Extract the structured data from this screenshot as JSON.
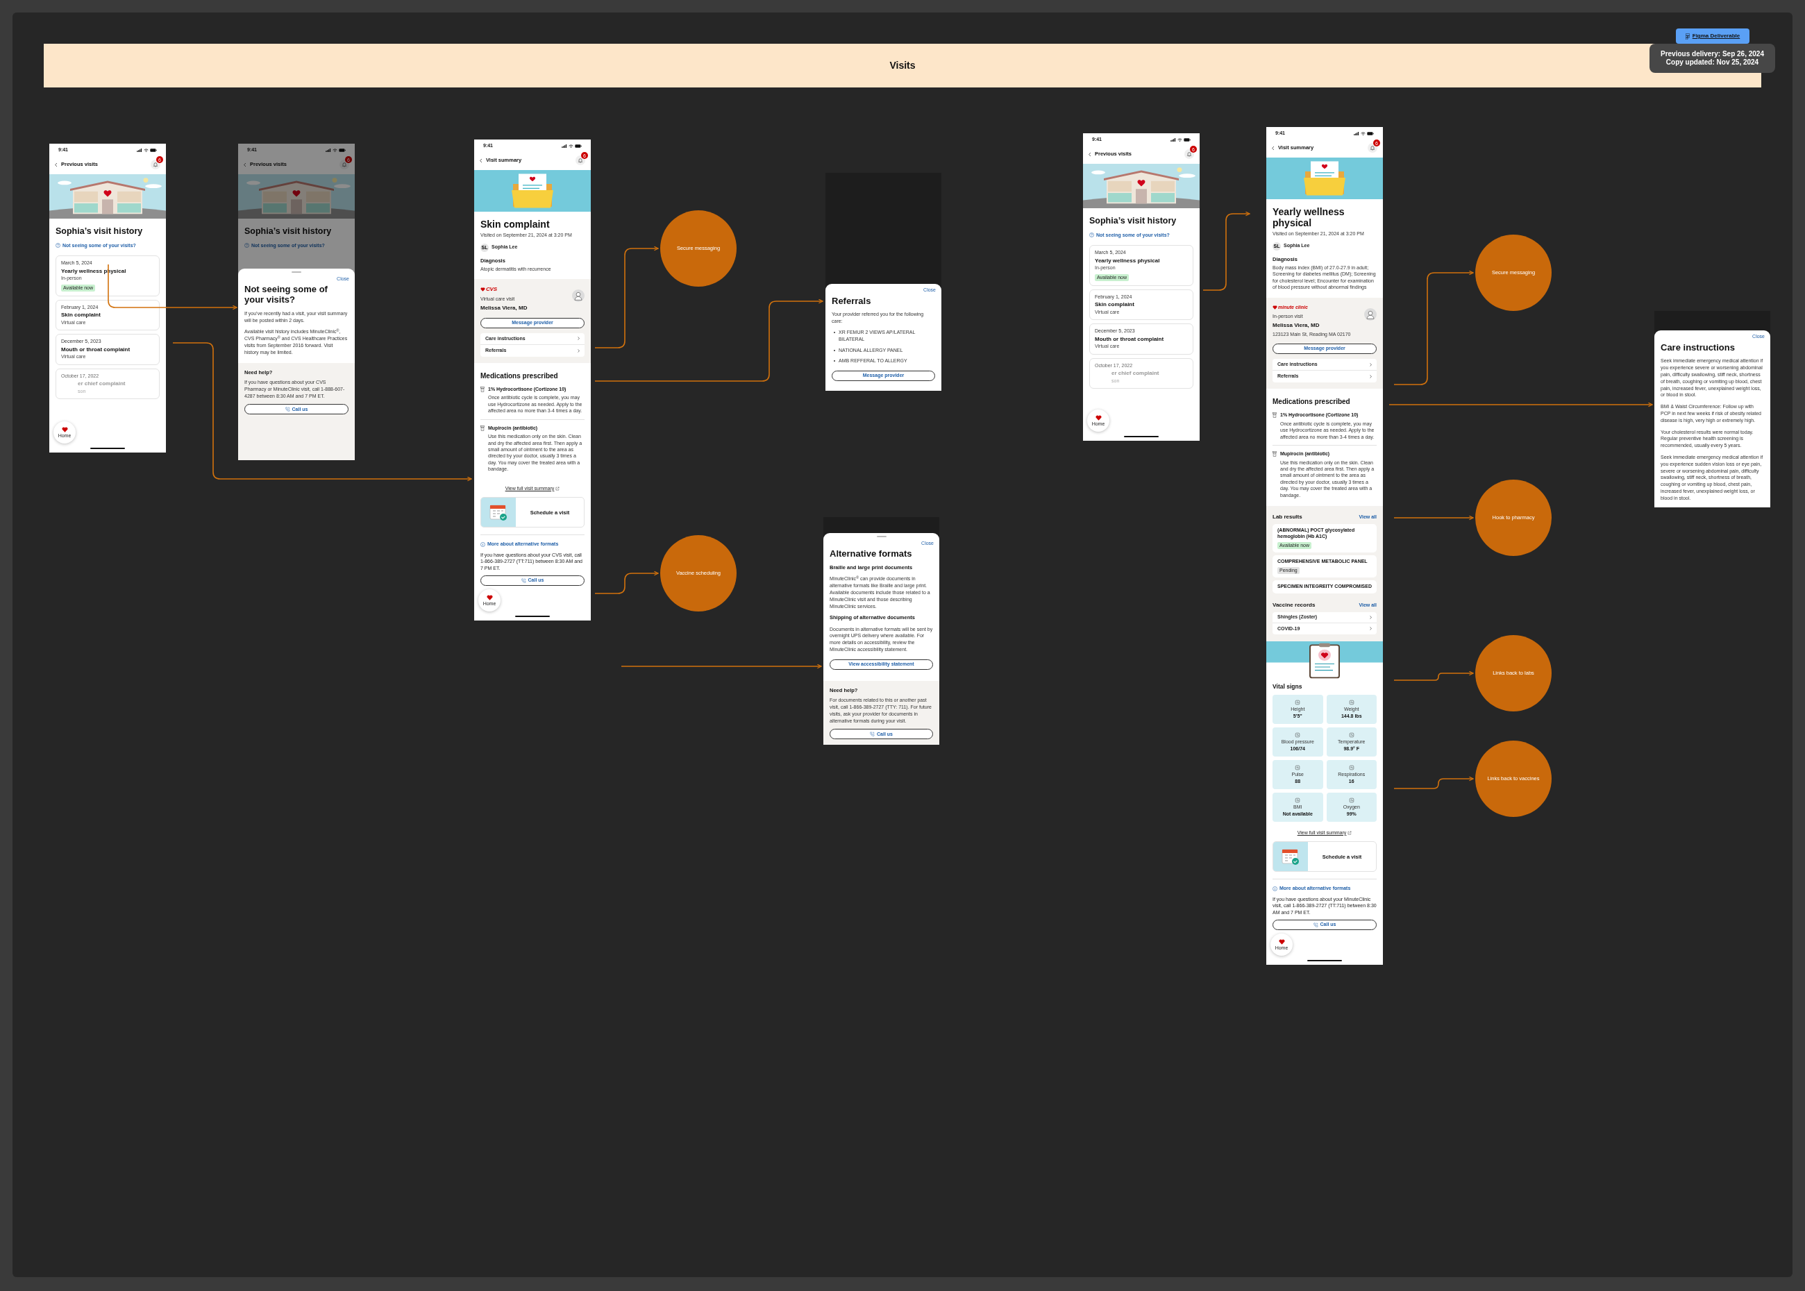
{
  "header": {
    "title": "Visits"
  },
  "deliverable_link": {
    "label": "Figma Deliverable"
  },
  "delivery_note": [
    "Previous delivery: Sep 26, 2024",
    "Copy updated: Nov 25, 2024"
  ],
  "frames": [
    {
      "kind": "history",
      "dimmed": false,
      "status_time": "9:41",
      "nav_title": "Previous visits",
      "notifications": "6",
      "title": "Sophia’s visit history",
      "help_link": "Not seeing some of your visits?",
      "visits": [
        {
          "date": "March 5, 2024",
          "title": "Yearly wellness physical",
          "type": "In-person",
          "faded": false,
          "tag": {
            "label": "Available now",
            "color": "#c8f0cf"
          }
        },
        {
          "date": "February 1, 2024",
          "title": "Skin complaint",
          "type": "Virtual care",
          "faded": false
        },
        {
          "date": "December 5, 2023",
          "title": "Mouth or throat complaint",
          "type": "Virtual care",
          "faded": false
        },
        {
          "date": "October 17, 2022",
          "title": "er chief complaint",
          "type": "son",
          "faded": true
        }
      ],
      "home": "Home"
    },
    {
      "kind": "history",
      "dimmed": true,
      "status_time": "9:41",
      "nav_title": "Previous visits",
      "notifications": "6",
      "title": "Sophia’s visit history",
      "help_link": "Not seeing some of your visits?",
      "sheet": {
        "handle": true,
        "close": "Close",
        "title": "Not seeing some of your visits?",
        "blocks": [
          {
            "kind": "paragraph",
            "text": "If you’ve recently had a visit, your visit summary will be posted within 2 days."
          },
          {
            "kind": "paragraph",
            "text": "Available visit history includes MinuteClinic$^{®}$, CVS Pharmacy$^{®}$ and CVS Healthcare Practices visits from September 2016 forward. Visit history may be limited."
          },
          {
            "kind": "help",
            "title": "Need help?",
            "text": "If you have questions about your CVS Pharmacy or MinuteClinic visit, call 1-888-607-4287 between 8:30 AM and 7 PM ET.",
            "button": "Call us"
          }
        ]
      }
    },
    {
      "kind": "summary",
      "status_time": "9:41",
      "nav_title": "Visit summary",
      "notifications": "6",
      "title": "Skin complaint",
      "visited": "Visited on September 21, 2024 at 3:20 PM",
      "patient_initials": "SL",
      "patient": "Sophia Lee",
      "diagnosis_label": "Diagnosis",
      "diagnosis": "Atopic dermatitis with recurrence",
      "brand": {
        "kind": "cvs",
        "label": "CVS"
      },
      "visit_type": "Virtual care visit",
      "provider": "Melissa Viera, MD",
      "message_button": "Message provider",
      "links": [
        "Care instructions",
        "Referrals"
      ],
      "meds_title": "Medications prescribed",
      "meds": [
        {
          "name": "1% Hydrocortisone (Cortizone 10)",
          "text": "Once antibiotic cycle is complete, you may use Hydrocortizone as needed. Apply to the affected area no more than 3-4 times a day."
        },
        {
          "name": "Mupirocin (antibiotic)",
          "text": "Use this medication only on the skin. Clean and dry the affected area first. Then apply a small amount of ointment to the area as directed by your doctor, usually 3 times a day. You may cover the treated area with a bandage."
        }
      ],
      "full_summary_link": "View full visit summary",
      "schedule": "Schedule a visit",
      "alt_formats_link": "More about alternative formats",
      "contact": "If you have questions about your CVS visit, call 1-866-389-2727 (TT:711) between 8:30 AM and 7 PM ET.",
      "call_button": "Call us",
      "home": "Home"
    },
    {
      "kind": "modal",
      "sheet": {
        "handle": false,
        "close": "Close",
        "title": "Referrals",
        "blocks": [
          {
            "kind": "paragraph",
            "text": "Your provider referred you for the following care:"
          },
          {
            "kind": "bullets",
            "items": [
              "XR FEMUR 2 VIEWS AP/LATERAL BILATERAL",
              "NATIONAL ALLERGY PANEL",
              "AMB REFFERAL TO ALLERGY"
            ]
          },
          {
            "kind": "button",
            "label": "Message provider"
          }
        ]
      }
    },
    {
      "kind": "modal",
      "sheet": {
        "handle": true,
        "close": "Close",
        "title": "Alternative formats",
        "blocks": [
          {
            "kind": "heading",
            "text": "Braille and large print documents"
          },
          {
            "kind": "paragraph",
            "text": "MinuteClinic$^{®}$ can provide documents in alternative formats like Braille and large print. Available documents include those related to a MinuteClinic visit and those describing MinuteClinic services."
          },
          {
            "kind": "heading",
            "text": "Shipping of alternative documents"
          },
          {
            "kind": "paragraph",
            "text": "Documents in alternative formats will be sent by overnight UPS delivery where available. For more details on accessibility, review the MinuteClinic accessibility statement."
          },
          {
            "kind": "button",
            "label": "View accessibility statement"
          },
          {
            "kind": "help",
            "title": "Need help?",
            "text": "For documents related to this or another past visit, call 1-866-389-2727 (TTY: 711). For future visits, ask your provider for documents in alternative formats during your visit.",
            "button": "Call us"
          }
        ]
      }
    },
    {
      "kind": "history",
      "dimmed": false,
      "status_time": "9:41",
      "nav_title": "Previous visits",
      "notifications": "6",
      "title": "Sophia’s visit history",
      "help_link": "Not seeing some of your visits?",
      "visits": [
        {
          "date": "March 5, 2024",
          "title": "Yearly wellness physical",
          "type": "In-person",
          "faded": false,
          "tag": {
            "label": "Available now",
            "color": "#c8f0cf"
          }
        },
        {
          "date": "February 1, 2024",
          "title": "Skin complaint",
          "type": "Virtual care",
          "faded": false
        },
        {
          "date": "December 5, 2023",
          "title": "Mouth or throat complaint",
          "type": "Virtual care",
          "faded": false
        },
        {
          "date": "October 17, 2022",
          "title": "er chief complaint",
          "type": "son",
          "faded": true
        }
      ],
      "home": "Home"
    },
    {
      "kind": "summary",
      "status_time": "9:41",
      "nav_title": "Visit summary",
      "notifications": "6",
      "title": "Yearly wellness physical",
      "visited": "Visited on September 21, 2024 at 3:20 PM",
      "patient_initials": "SL",
      "patient": "Sophia Lee",
      "diagnosis_label": "Diagnosis",
      "diagnosis": "Body mass index (BMI) of 27.0-27.9 in adult; Screening for diabetes mellitus (DM); Screening for cholesterol level; Encounter for examination of blood pressure without abnormal findings",
      "brand": {
        "kind": "minuteclinic",
        "label": "minute clinic"
      },
      "visit_type": "In-person visit",
      "provider": "Melissa Viera, MD",
      "address": "123123 Main St, Reading MA 02170",
      "message_button": "Message provider",
      "links": [
        "Care instructions",
        "Referrals"
      ],
      "meds_title": "Medications prescribed",
      "meds": [
        {
          "name": "1% Hydrocortisone (Cortizone 10)",
          "text": "Once antibiotic cycle is complete, you may use Hydrocortizone as needed. Apply to the affected area no more than 3-4 times a day."
        },
        {
          "name": "Mupirocin (antibiotic)",
          "text": "Use this medication only on the skin. Clean and dry the affected area first. Then apply a small amount of ointment to the area as directed by your doctor, usually 3 times a day. You may cover the treated area with a bandage."
        }
      ],
      "labs": {
        "title": "Lab results",
        "view_all": "View all",
        "items": [
          {
            "name": "(ABNORMAL) POCT glycosylated hemoglobin (Hb A1C)",
            "tag": {
              "label": "Available now",
              "color": "#c8f0cf"
            }
          },
          {
            "name": "COMPREHENSIVE METABOLIC PANEL",
            "tag": {
              "label": "Pending",
              "color": "#e2e2e2"
            }
          },
          {
            "name": "SPECIMEN INTEGREITY COMPROMISED"
          }
        ]
      },
      "vaccines": {
        "title": "Vaccine records",
        "view_all": "View all",
        "items": [
          "Shingles (Zoster)",
          "COVID-19"
        ]
      },
      "vitals": {
        "title": "Vital signs",
        "items": [
          {
            "label": "Height",
            "value": "5’5”"
          },
          {
            "label": "Weight",
            "value": "144.8 lbs"
          },
          {
            "label": "Blood pressure",
            "value": "106/74"
          },
          {
            "label": "Temperature",
            "value": "98.9° F"
          },
          {
            "label": "Pulse",
            "value": "88"
          },
          {
            "label": "Respirations",
            "value": "16"
          },
          {
            "label": "BMI",
            "value": "Not available"
          },
          {
            "label": "Oxygen",
            "value": "99%"
          }
        ]
      },
      "full_summary_link": "View full visit summary",
      "schedule": "Schedule a visit",
      "alt_formats_link": "More about alternative formats",
      "contact": "If you have questions about your MinuteClinic visit, call 1-866-389-2727 (TT:711) between 8:30 AM and 7 PM ET.",
      "call_button": "Call us",
      "home": "Home"
    },
    {
      "kind": "modal",
      "sheet": {
        "handle": false,
        "close": "Close",
        "title": "Care instructions",
        "blocks": [
          {
            "kind": "paragraph",
            "text": "Seek immediate emergency medical attention if you experience severe or worsening abdominal pain, difficulty swallowing, stiff neck, shortness of breath, coughing or vomiting up blood, chest pain, increased fever, unexplained weight loss, or blood in stool."
          },
          {
            "kind": "paragraph",
            "text": "BMI & Waist Circumference: Follow up with PCP in next few weeks if risk of obesity related disease is high, very high or extremely high."
          },
          {
            "kind": "paragraph",
            "text": "Your cholesterol results were normal today. Regular preventive health screening is recommended, usually every 5 years."
          },
          {
            "kind": "paragraph",
            "text": "Seek immediate emergency medical attention if you experience sudden vision loss or eye pain, severe or worsening abdominal pain, difficulty swallowing, stiff neck, shortness of breath, coughing or vomiting up blood, chest pain, increased fever, unexplained weight loss, or blood in stool."
          }
        ]
      }
    }
  ],
  "flow_notes": [
    {
      "label": "Secure messaging"
    },
    {
      "label": "Vaccine scheduling"
    },
    {
      "label": "Secure messaging"
    },
    {
      "label": "Hook to pharmacy"
    },
    {
      "label": "Links back to labs"
    },
    {
      "label": "Links back to vaccines"
    }
  ]
}
